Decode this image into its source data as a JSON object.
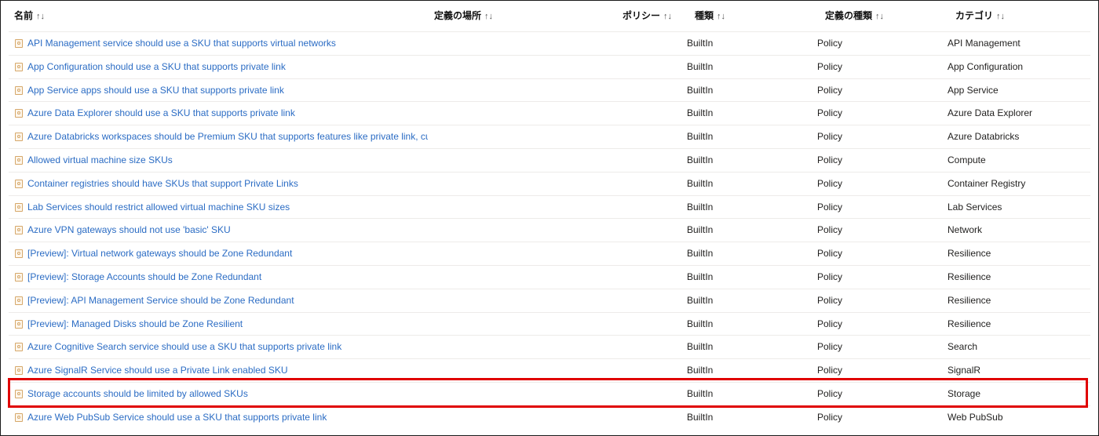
{
  "columns": {
    "name": "名前",
    "location": "定義の場所",
    "policy": "ポリシー",
    "type": "種類",
    "definition_type": "定義の種類",
    "category": "カテゴリ",
    "sort_icon": "↑↓"
  },
  "rows": [
    {
      "name": "API Management service should use a SKU that supports virtual networks",
      "type": "BuiltIn",
      "definition_type": "Policy",
      "category": "API Management"
    },
    {
      "name": "App Configuration should use a SKU that supports private link",
      "type": "BuiltIn",
      "definition_type": "Policy",
      "category": "App Configuration"
    },
    {
      "name": "App Service apps should use a SKU that supports private link",
      "type": "BuiltIn",
      "definition_type": "Policy",
      "category": "App Service"
    },
    {
      "name": "Azure Data Explorer should use a SKU that supports private link",
      "type": "BuiltIn",
      "definition_type": "Policy",
      "category": "Azure Data Explorer"
    },
    {
      "name": "Azure Databricks workspaces should be Premium SKU that supports features like private link, cu",
      "type": "BuiltIn",
      "definition_type": "Policy",
      "category": "Azure Databricks"
    },
    {
      "name": "Allowed virtual machine size SKUs",
      "type": "BuiltIn",
      "definition_type": "Policy",
      "category": "Compute"
    },
    {
      "name": "Container registries should have SKUs that support Private Links",
      "type": "BuiltIn",
      "definition_type": "Policy",
      "category": "Container Registry"
    },
    {
      "name": "Lab Services should restrict allowed virtual machine SKU sizes",
      "type": "BuiltIn",
      "definition_type": "Policy",
      "category": "Lab Services"
    },
    {
      "name": "Azure VPN gateways should not use 'basic' SKU",
      "type": "BuiltIn",
      "definition_type": "Policy",
      "category": "Network"
    },
    {
      "name": "[Preview]: Virtual network gateways should be Zone Redundant",
      "type": "BuiltIn",
      "definition_type": "Policy",
      "category": "Resilience"
    },
    {
      "name": "[Preview]: Storage Accounts should be Zone Redundant",
      "type": "BuiltIn",
      "definition_type": "Policy",
      "category": "Resilience"
    },
    {
      "name": "[Preview]: API Management Service should be Zone Redundant",
      "type": "BuiltIn",
      "definition_type": "Policy",
      "category": "Resilience"
    },
    {
      "name": "[Preview]: Managed Disks should be Zone Resilient",
      "type": "BuiltIn",
      "definition_type": "Policy",
      "category": "Resilience"
    },
    {
      "name": "Azure Cognitive Search service should use a SKU that supports private link",
      "type": "BuiltIn",
      "definition_type": "Policy",
      "category": "Search"
    },
    {
      "name": "Azure SignalR Service should use a Private Link enabled SKU",
      "type": "BuiltIn",
      "definition_type": "Policy",
      "category": "SignalR"
    },
    {
      "name": "Storage accounts should be limited by allowed SKUs",
      "type": "BuiltIn",
      "definition_type": "Policy",
      "category": "Storage"
    },
    {
      "name": "Azure Web PubSub Service should use a SKU that supports private link",
      "type": "BuiltIn",
      "definition_type": "Policy",
      "category": "Web PubSub"
    }
  ],
  "highlight_color": "#e00000",
  "link_color": "#2b6cc4",
  "row_icon": "policy-definition-icon"
}
